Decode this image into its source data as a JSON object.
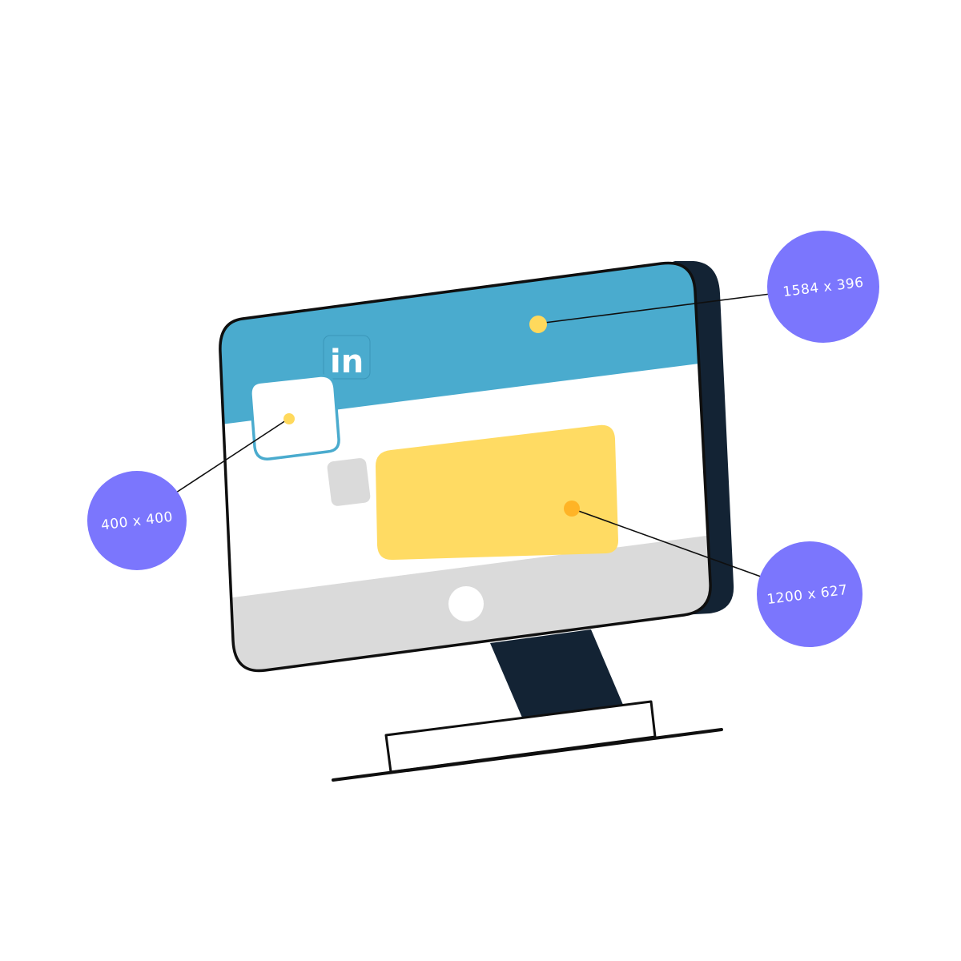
{
  "colors": {
    "monitor_back": "#132334",
    "banner": "#4AABCE",
    "screen": "#FFFFFF",
    "footer": "#DADADA",
    "post_card": "#FFDB63",
    "profile_border": "#4AABCE",
    "marker_yellow": "#FFD95C",
    "marker_orange": "#FFB426",
    "callout_fill": "#7B76FD",
    "callout_text": "#FFFFFF",
    "outline": "#0F0F0F"
  },
  "linkedin_logo": {
    "text": "in",
    "icon": "linkedin-icon"
  },
  "callouts": {
    "banner": {
      "label": "1584 x 396"
    },
    "profile": {
      "label": "400 x 400"
    },
    "post": {
      "label": "1200 x 627"
    }
  }
}
